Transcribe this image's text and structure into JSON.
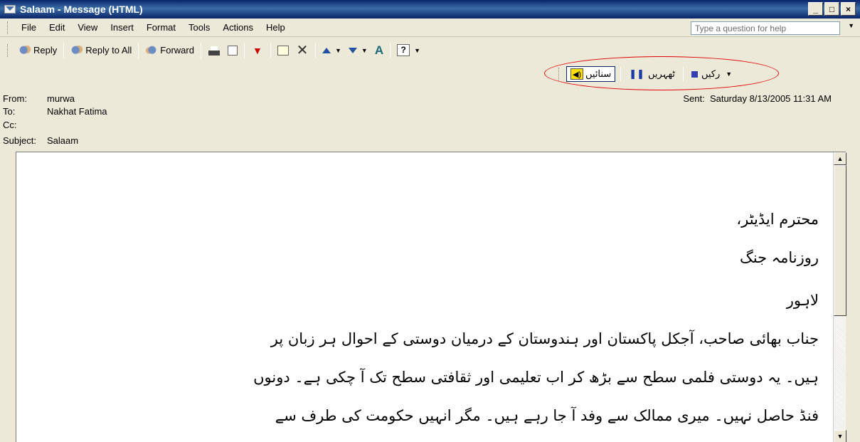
{
  "window": {
    "title": "Salaam - Message (HTML)",
    "buttons": [
      "_",
      "□",
      "×"
    ]
  },
  "menubar": {
    "items": [
      {
        "label": "File"
      },
      {
        "label": "Edit"
      },
      {
        "label": "View"
      },
      {
        "label": "Insert"
      },
      {
        "label": "Format"
      },
      {
        "label": "Tools"
      },
      {
        "label": "Actions"
      },
      {
        "label": "Help"
      }
    ],
    "help_placeholder": "Type a question for help"
  },
  "toolbar": {
    "reply_label": "Reply",
    "reply_all_label": "Reply to All",
    "forward_label": "Forward",
    "icons": [
      "reply-icon",
      "reply-all-icon",
      "forward-icon",
      "print-icon",
      "copy-icon",
      "flag-icon",
      "move-icon",
      "delete-icon",
      "previous-item-icon",
      "next-item-icon",
      "font-size-icon",
      "help-icon"
    ]
  },
  "speech_bar": {
    "speak_label": "سنائیں",
    "pause_label": "ٹھہریں",
    "stop_label": "رکیں",
    "highlight_color": "#e00000"
  },
  "message": {
    "from_label": "From:",
    "from_value": "murwa",
    "to_label": "To:",
    "to_value": "Nakhat Fatima",
    "cc_label": "Cc:",
    "cc_value": "",
    "subject_label": "Subject:",
    "subject_value": "Salaam",
    "sent_label": "Sent:",
    "sent_value": "Saturday 8/13/2005 11:31 AM"
  },
  "body": {
    "lines": [
      "محترم ایڈیٹر،",
      "روزنامہ جنگ",
      "لاہور",
      "جناب بھائی صاحب، آجکل پاکستان اور ہندوستان کے درمیان دوستی کے احوال ہر زبان پر",
      "ہیں۔ یہ دوستی فلمی سطح سے بڑھ کر اب تعلیمی اور ثقافتی سطح تک آ چکی ہے۔ دونوں",
      "فنڈ حاصل نہیں۔ میری ممالک سے وفد آ جا رہے ہیں۔ مگر انہیں حکومت کی طرف سے"
    ]
  }
}
